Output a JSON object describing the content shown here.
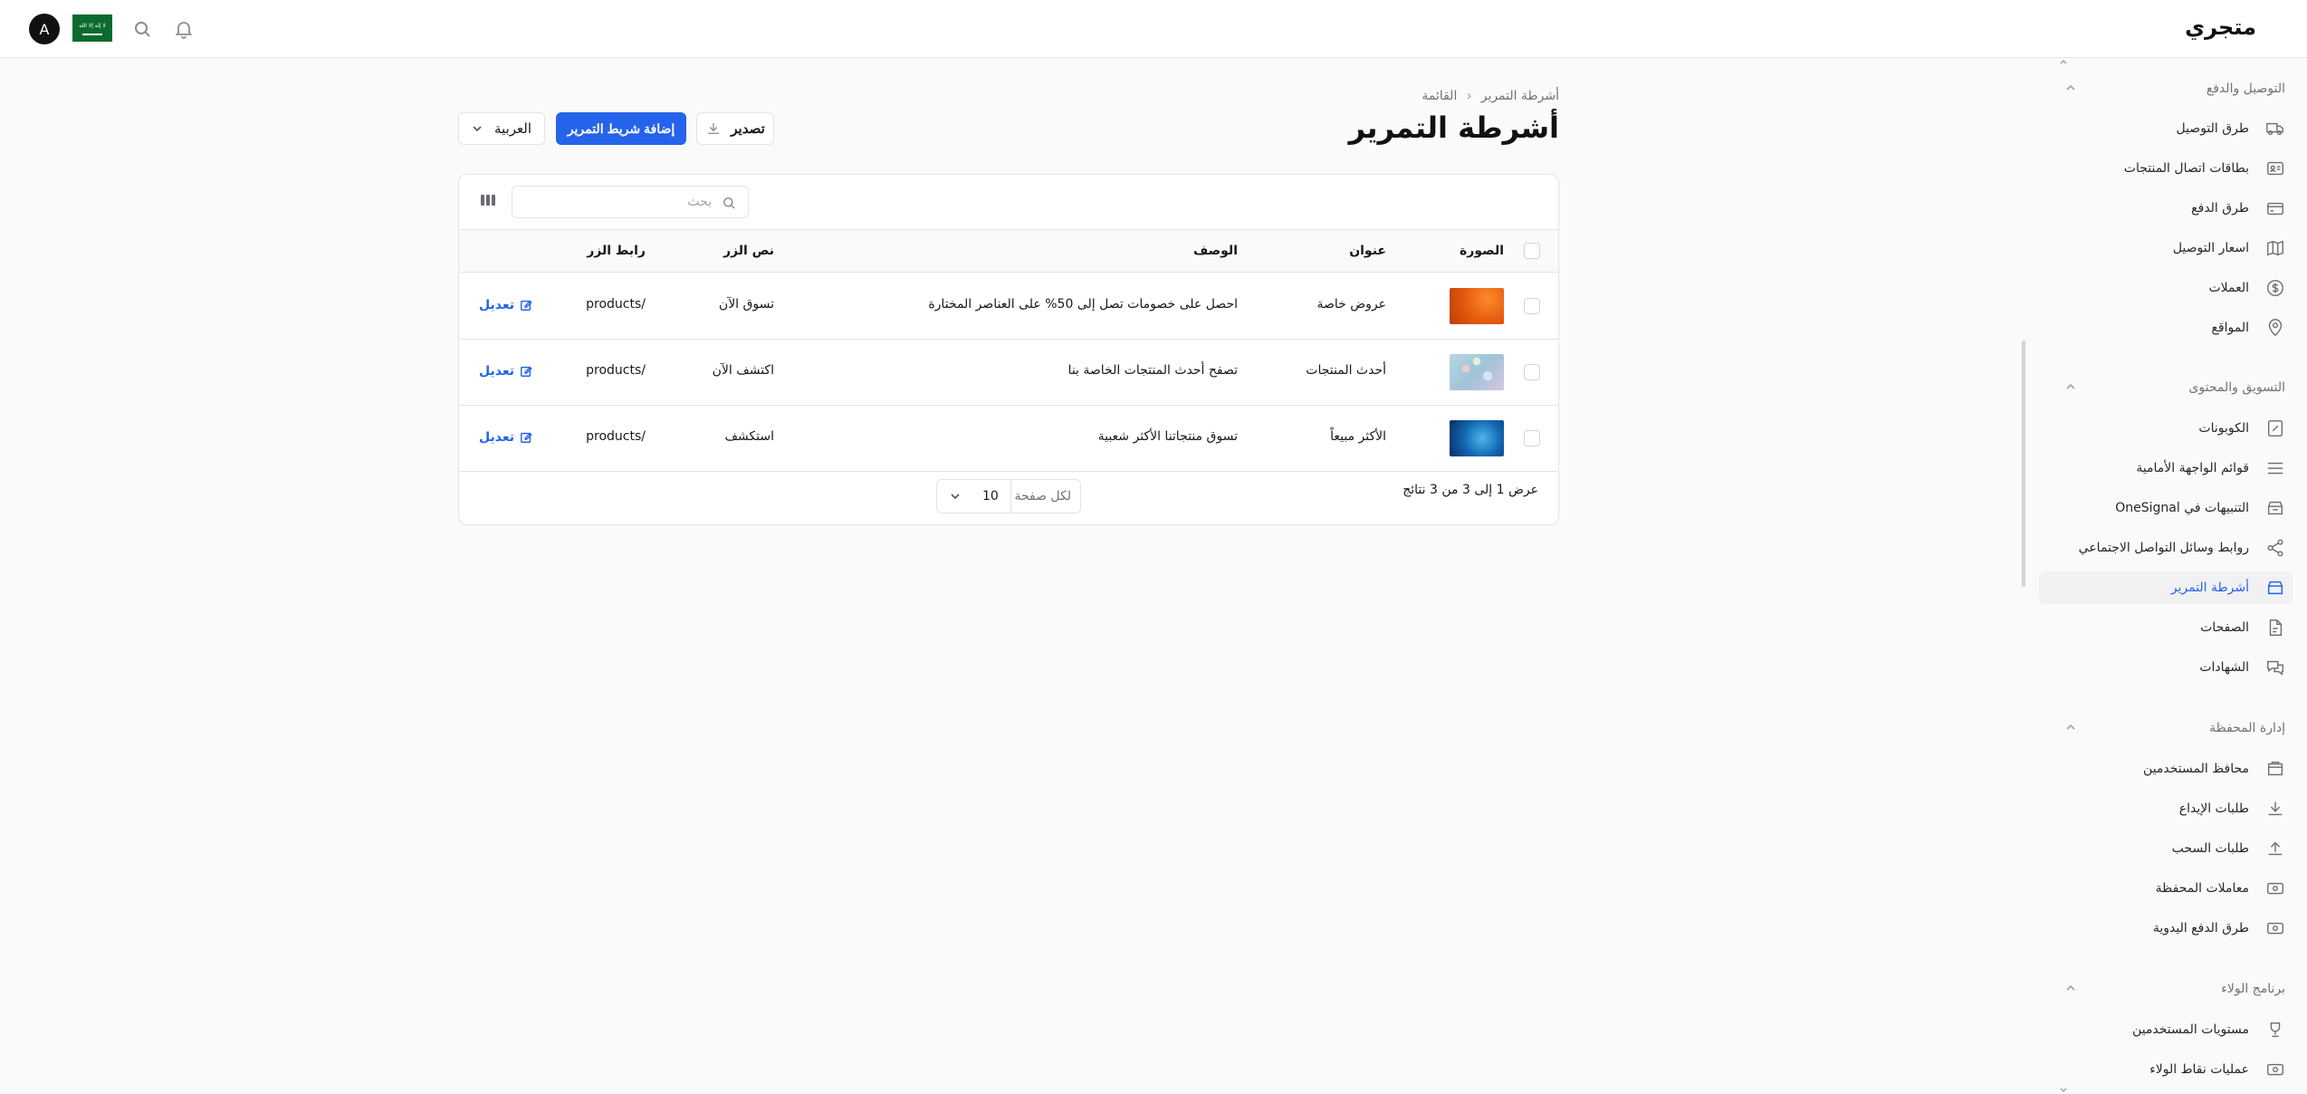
{
  "app": {
    "brand": "متجري",
    "avatar_initial": "A",
    "flag_text": "لا إله إلا الله"
  },
  "sidebar": {
    "sections": [
      {
        "title": "التوصيل والدفع",
        "items": [
          {
            "label": "طرق التوصيل",
            "icon": "truck-icon"
          },
          {
            "label": "بطاقات اتصال المنتجات",
            "icon": "contact-card-icon"
          },
          {
            "label": "طرق الدفع",
            "icon": "credit-card-icon"
          },
          {
            "label": "اسعار التوصيل",
            "icon": "map-icon"
          },
          {
            "label": "العملات",
            "icon": "dollar-icon"
          },
          {
            "label": "المواقع",
            "icon": "location-pin-icon"
          }
        ]
      },
      {
        "title": "التسويق والمحتوى",
        "items": [
          {
            "label": "الكوبونات",
            "icon": "coupon-icon"
          },
          {
            "label": "قوائم الواجهة الأمامية",
            "icon": "menu-lines-icon"
          },
          {
            "label": "التنبيهات في OneSignal",
            "icon": "notification-box-icon"
          },
          {
            "label": "روابط وسائل التواصل الاجتماعي",
            "icon": "share-icon"
          },
          {
            "label": "أشرطة التمرير",
            "icon": "slider-icon",
            "active": true
          },
          {
            "label": "الصفحات",
            "icon": "page-icon"
          },
          {
            "label": "الشهادات",
            "icon": "chat-bubbles-icon"
          }
        ]
      },
      {
        "title": "إدارة المحفظة",
        "items": [
          {
            "label": "محافظ المستخدمين",
            "icon": "wallet-icon"
          },
          {
            "label": "طلبات الإيداع",
            "icon": "download-icon"
          },
          {
            "label": "طلبات السحب",
            "icon": "upload-icon"
          },
          {
            "label": "معاملات المحفظة",
            "icon": "money-icon"
          },
          {
            "label": "طرق الدفع اليدوية",
            "icon": "cash-icon"
          }
        ]
      },
      {
        "title": "برنامج الولاء",
        "items": [
          {
            "label": "مستويات المستخدمين",
            "icon": "trophy-icon"
          },
          {
            "label": "عمليات نقاط الولاء",
            "icon": "points-icon"
          }
        ]
      }
    ]
  },
  "breadcrumb": {
    "parent": "أشرطة التمرير",
    "current": "القائمة"
  },
  "page": {
    "title": "أشرطة التمرير"
  },
  "actions": {
    "add_label": "إضافة شريط التمرير",
    "export_label": "تصدير",
    "language": "العربية"
  },
  "table": {
    "search_placeholder": "بحث",
    "columns": {
      "image": "الصورة",
      "title": "عنوان",
      "description": "الوصف",
      "button_text": "نص الزر",
      "button_link": "رابط الزر"
    },
    "rows": [
      {
        "title": "عروض خاصة",
        "description": "احصل على خصومات تصل إلى 50% على العناصر المختارة",
        "button_text": "تسوق الآن",
        "button_link": "/products",
        "action": "تعديل"
      },
      {
        "title": "أحدث المنتجات",
        "description": "تصفح أحدث المنتجات الخاصة بنا",
        "button_text": "اكتشف الآن",
        "button_link": "/products",
        "action": "تعديل"
      },
      {
        "title": "الأكثر مبيعاً",
        "description": "تسوق منتجاتنا الأكثر شعبية",
        "button_text": "استكشف",
        "button_link": "/products",
        "action": "تعديل"
      }
    ],
    "pagination": {
      "summary": "عرض 1 إلى 3 من 3 نتائج",
      "per_page_label": "لكل صفحة",
      "per_page_value": "10"
    }
  }
}
